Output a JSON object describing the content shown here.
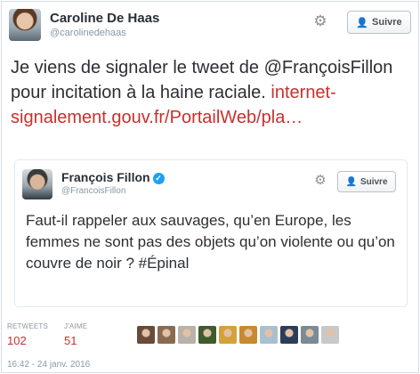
{
  "tweet": {
    "author_name": "Caroline De Haas",
    "author_handle": "@carolinedehaas",
    "follow_label": "Suivre",
    "text_prefix": "Je viens de signaler le tweet de @FrançoisFillon pour incitation à la haine raciale. ",
    "link_text": "internet-signalement.gouv.fr/PortailWeb/pla…",
    "link_color": "#c8302e",
    "quoted": {
      "author_name": "François Fillon",
      "author_handle": "@FrancoisFillon",
      "follow_label": "Suivre",
      "text": "Faut-il rappeler aux sauvages, qu’en Europe, les femmes ne sont pas des objets qu’on violente ou qu’on couvre de noir ? #Épinal"
    },
    "stats": {
      "retweets_label": "RETWEETS",
      "retweets_value": "102",
      "likes_label": "J'AIME",
      "likes_value": "51"
    },
    "timestamp": "16:42 - 24 janv. 2016",
    "liker_avatars": [
      "#6b4a3a",
      "#8a6a50",
      "#b8b2a8",
      "#3e5c2e",
      "#d4a23a",
      "#c9892e",
      "#a8c0d0",
      "#2c3d5a",
      "#7a8a96",
      "#c8c8c8"
    ]
  }
}
